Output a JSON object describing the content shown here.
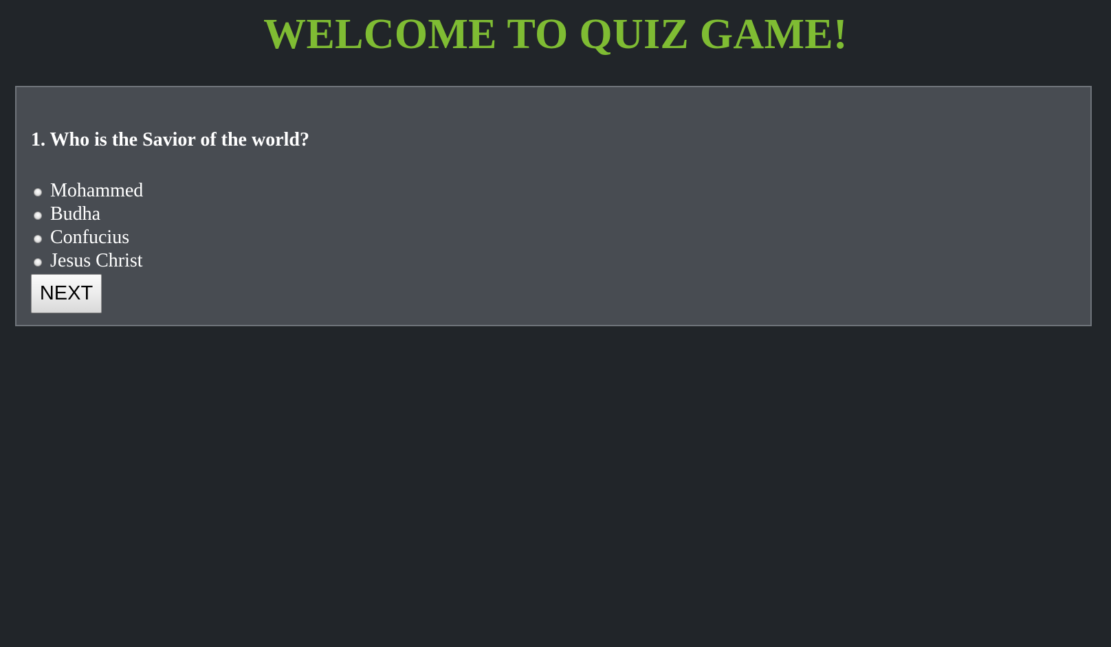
{
  "header": {
    "title": "WELCOME TO QUIZ GAME!"
  },
  "quiz": {
    "question": "1. Who is the Savior of the world?",
    "options": [
      {
        "label": "Mohammed",
        "selected": false
      },
      {
        "label": "Budha",
        "selected": false
      },
      {
        "label": "Confucius",
        "selected": false
      },
      {
        "label": "Jesus Christ",
        "selected": false
      }
    ],
    "next_label": "NEXT"
  },
  "colors": {
    "background": "#212529",
    "panel": "#484c52",
    "title_accent": "#7fbc33",
    "text": "#ffffff"
  }
}
